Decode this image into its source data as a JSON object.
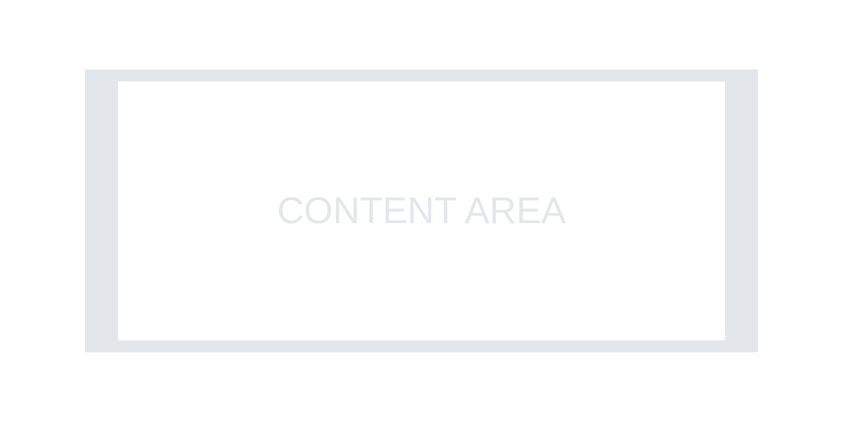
{
  "content": {
    "label": "CONTENT AREA"
  },
  "colors": {
    "page_background": "#ffffff",
    "frame": "#e3e6ea",
    "content_background": "#ffffff",
    "label_text": "#e3e6ea"
  }
}
